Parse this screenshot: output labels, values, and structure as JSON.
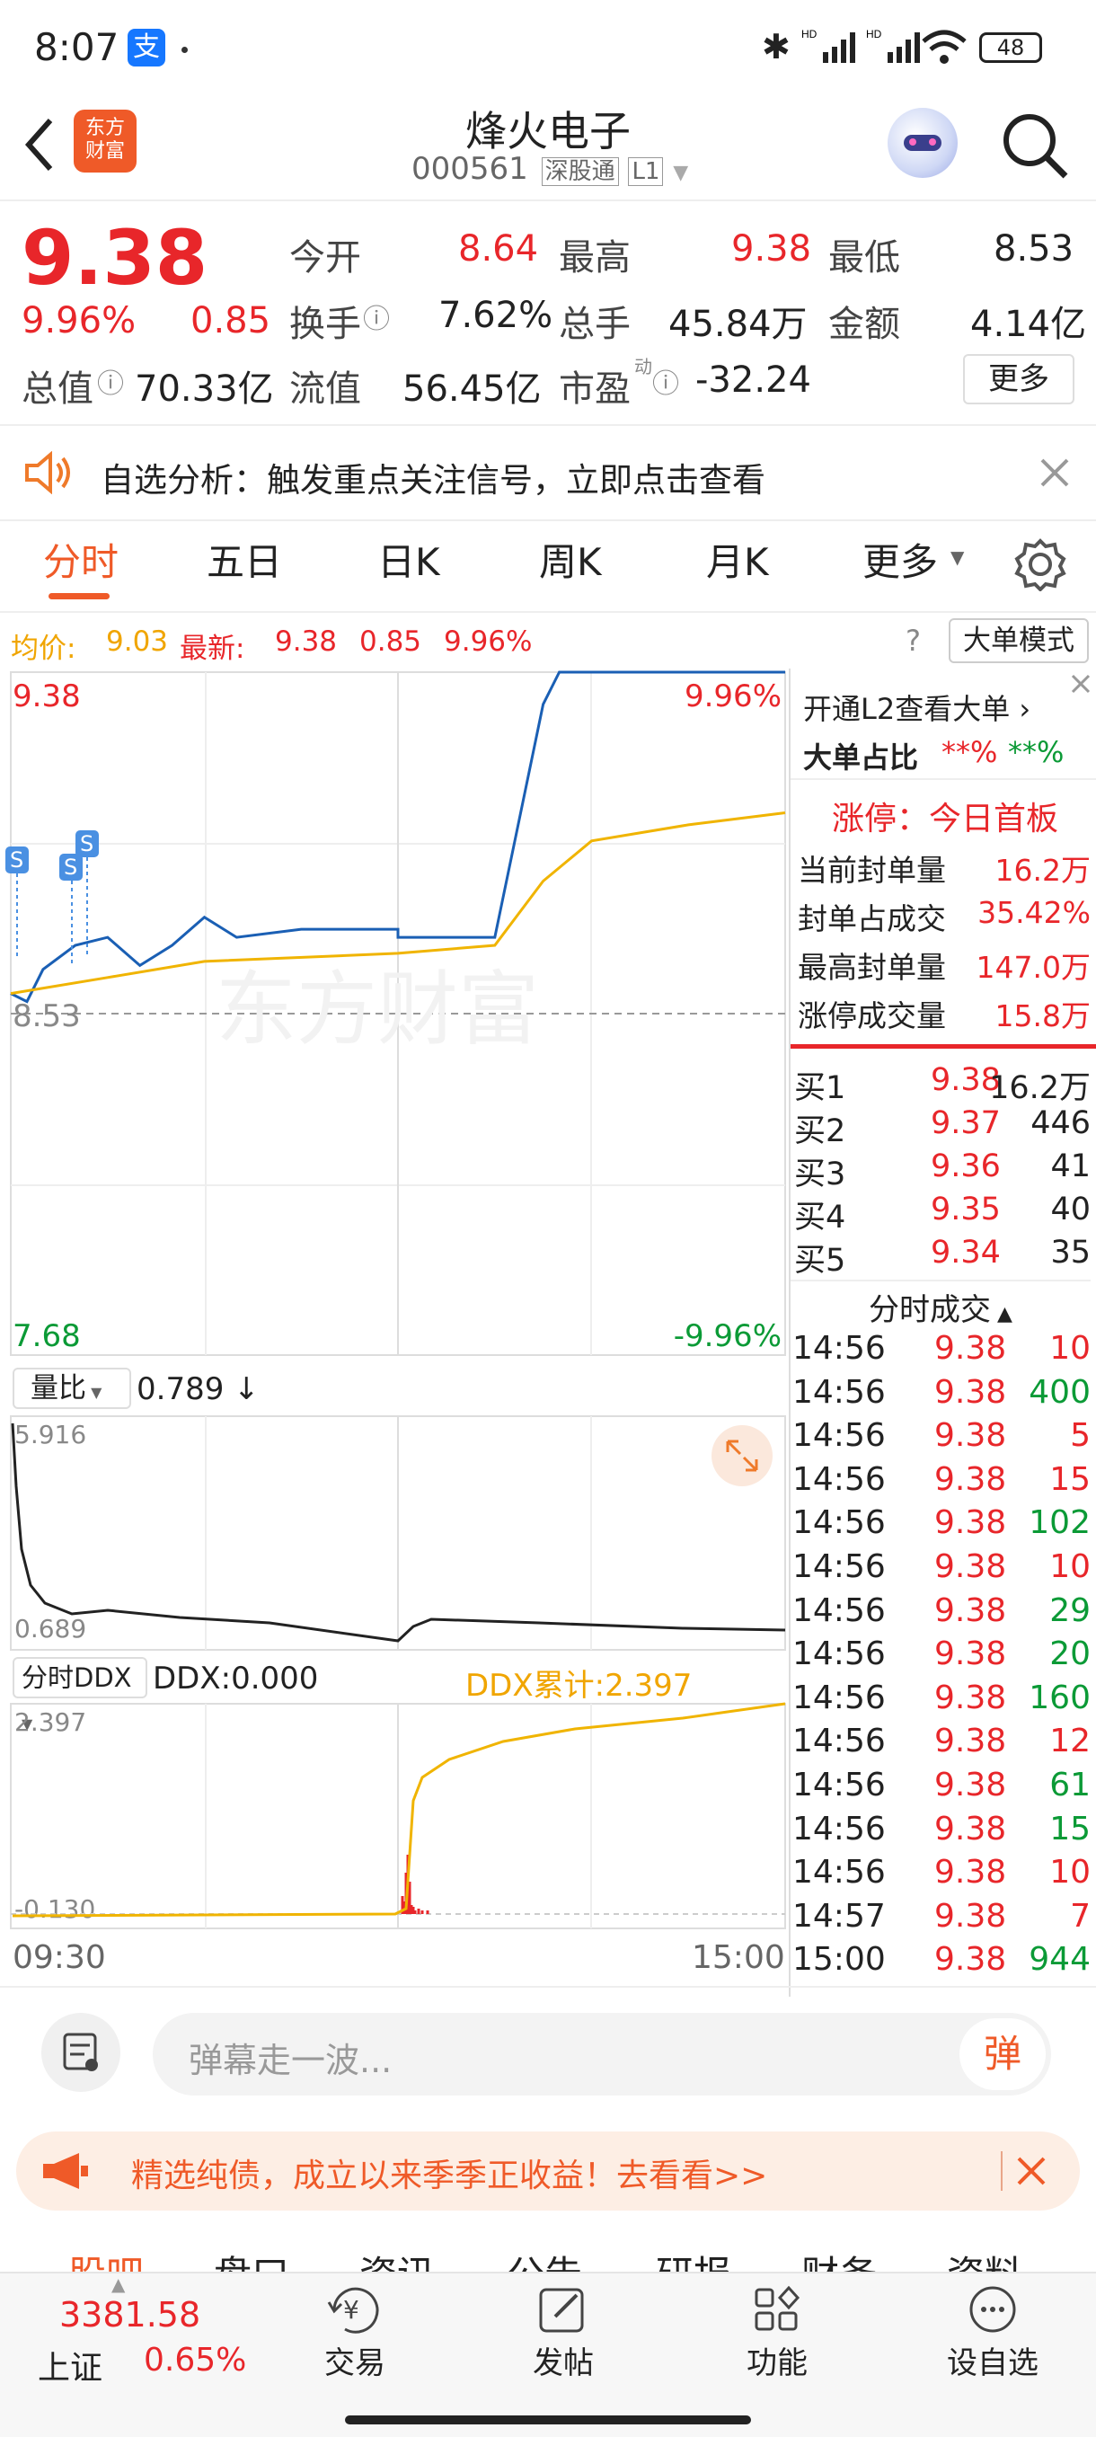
{
  "status_bar": {
    "time": "8:07",
    "app_icon": "支",
    "battery": "48"
  },
  "header": {
    "title": "烽火电子",
    "code": "000561",
    "tag1": "深股通",
    "tag2": "L1",
    "logo_line1": "东方",
    "logo_line2": "财富"
  },
  "quote": {
    "price": "9.38",
    "pct": "9.96%",
    "change": "0.85",
    "open_label": "今开",
    "open": "8.64",
    "high_label": "最高",
    "high": "9.38",
    "low_label": "最低",
    "low": "8.53",
    "turnover_label": "换手",
    "turnover": "7.62%",
    "volume_label": "总手",
    "volume": "45.84万",
    "amount_label": "金额",
    "amount": "4.14亿",
    "mktcap_label": "总值",
    "mktcap": "70.33亿",
    "float_label": "流值",
    "float": "56.45亿",
    "pe_label": "市盈",
    "pe_sup": "动",
    "pe": "-32.24",
    "more": "更多"
  },
  "notice": {
    "text": "自选分析：触发重点关注信号，立即点击查看"
  },
  "tabs": [
    "分时",
    "五日",
    "日K",
    "周K",
    "月K",
    "更多"
  ],
  "info_line": {
    "avg_label": "均价:",
    "avg": "9.03",
    "latest_label": "最新:",
    "latest": "9.38",
    "chg": "0.85",
    "pct": "9.96%",
    "mode": "大单模式"
  },
  "chart": {
    "y_top": "9.38",
    "y_mid": "8.53",
    "y_bot": "7.68",
    "pct_top": "9.96%",
    "pct_bot": "-9.96%",
    "watermark": "东方财富",
    "x_start": "09:30",
    "x_end": "15:00",
    "vol_ratio_label": "量比",
    "vol_ratio": "0.789 ↓",
    "vol_top": "5.916",
    "vol_bot": "0.689",
    "ddx_label": "分时DDX",
    "ddx": "DDX:0.000",
    "ddx_cum": "DDX累计:2.397",
    "ddx_top": "2.397",
    "ddx_bot": "-0.130"
  },
  "chart_data": {
    "type": "line",
    "title": "",
    "series": [
      {
        "name": "最新",
        "x": [
          "09:30",
          "09:35",
          "09:40",
          "09:50",
          "10:00",
          "10:10",
          "10:20",
          "10:30",
          "10:40",
          "11:00",
          "11:30",
          "13:00",
          "13:30",
          "13:45",
          "13:50",
          "14:00",
          "14:30",
          "15:00"
        ],
        "values": [
          8.58,
          8.56,
          8.64,
          8.7,
          8.72,
          8.65,
          8.7,
          8.77,
          8.72,
          8.74,
          8.74,
          8.72,
          8.72,
          9.3,
          9.38,
          9.38,
          9.38,
          9.38
        ]
      },
      {
        "name": "均价",
        "x": [
          "09:30",
          "10:00",
          "10:30",
          "11:30",
          "13:30",
          "13:45",
          "14:00",
          "14:30",
          "15:00"
        ],
        "values": [
          8.58,
          8.62,
          8.66,
          8.68,
          8.7,
          8.86,
          8.96,
          9.0,
          9.03
        ]
      }
    ],
    "ylim": [
      7.68,
      9.38
    ]
  },
  "l2": {
    "title": "开通L2查看大单",
    "ratio_label": "大单占比",
    "ratio_a": "**%",
    "ratio_b": "**%",
    "limit_title": "涨停：今日首板",
    "rows": [
      {
        "label": "当前封单量",
        "value": "16.2万"
      },
      {
        "label": "封单占成交",
        "value": "35.42%"
      },
      {
        "label": "最高封单量",
        "value": "147.0万"
      },
      {
        "label": "涨停成交量",
        "value": "15.8万"
      }
    ]
  },
  "orderbook": [
    {
      "label": "买1",
      "price": "9.38",
      "vol": "16.2万"
    },
    {
      "label": "买2",
      "price": "9.37",
      "vol": "446"
    },
    {
      "label": "买3",
      "price": "9.36",
      "vol": "41"
    },
    {
      "label": "买4",
      "price": "9.35",
      "vol": "40"
    },
    {
      "label": "买5",
      "price": "9.34",
      "vol": "35"
    }
  ],
  "ticks_title": "分时成交",
  "ticks": [
    {
      "t": "14:56",
      "p": "9.38",
      "v": "10",
      "c": "red"
    },
    {
      "t": "14:56",
      "p": "9.38",
      "v": "400",
      "c": "green"
    },
    {
      "t": "14:56",
      "p": "9.38",
      "v": "5",
      "c": "red"
    },
    {
      "t": "14:56",
      "p": "9.38",
      "v": "15",
      "c": "red"
    },
    {
      "t": "14:56",
      "p": "9.38",
      "v": "102",
      "c": "green"
    },
    {
      "t": "14:56",
      "p": "9.38",
      "v": "10",
      "c": "red"
    },
    {
      "t": "14:56",
      "p": "9.38",
      "v": "29",
      "c": "green"
    },
    {
      "t": "14:56",
      "p": "9.38",
      "v": "20",
      "c": "green"
    },
    {
      "t": "14:56",
      "p": "9.38",
      "v": "160",
      "c": "green"
    },
    {
      "t": "14:56",
      "p": "9.38",
      "v": "12",
      "c": "red"
    },
    {
      "t": "14:56",
      "p": "9.38",
      "v": "61",
      "c": "green"
    },
    {
      "t": "14:56",
      "p": "9.38",
      "v": "15",
      "c": "green"
    },
    {
      "t": "14:56",
      "p": "9.38",
      "v": "10",
      "c": "red"
    },
    {
      "t": "14:57",
      "p": "9.38",
      "v": "7",
      "c": "red"
    },
    {
      "t": "15:00",
      "p": "9.38",
      "v": "944",
      "c": "green"
    }
  ],
  "comment": {
    "placeholder": "弹幕走一波...",
    "danmu": "弹"
  },
  "ad": {
    "text": "精选纯债，成立以来季季正收益！去看看>>"
  },
  "sub_tabs": [
    "股吧",
    "盘口",
    "资讯",
    "公告",
    "研报",
    "财务",
    "资料"
  ],
  "bottom_nav": {
    "index_value": "3381.58",
    "index_name": "上证",
    "index_pct": "0.65%",
    "trade": "交易",
    "post": "发帖",
    "func": "功能",
    "watch": "设自选"
  }
}
